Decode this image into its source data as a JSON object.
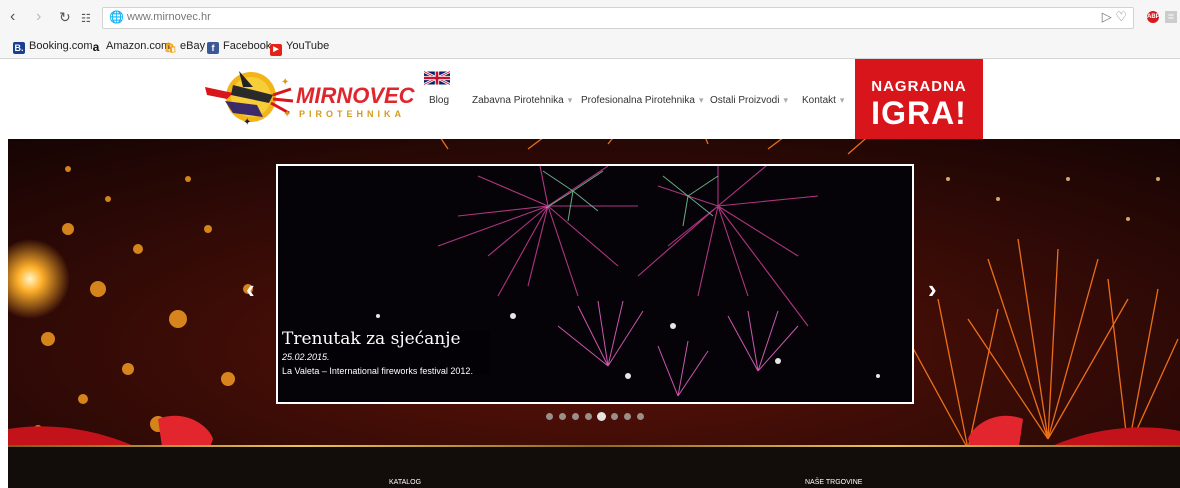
{
  "browser": {
    "url": "www.mirnovec.hr",
    "back_icon": "back-arrow-icon",
    "forward_icon": "forward-arrow-icon",
    "reload_icon": "reload-icon",
    "apps_icon": "speed-dial-icon",
    "site_icon": "globe-icon",
    "bookmarks": [
      {
        "label": "Booking.com",
        "icon": "B.",
        "color": "#1a3f8f"
      },
      {
        "label": "Amazon.com",
        "icon": "a",
        "color": "#111111"
      },
      {
        "label": "eBay",
        "icon": "🛍",
        "color": "#f2a41d"
      },
      {
        "label": "Facebook",
        "icon": "f",
        "color": "#3b5998"
      },
      {
        "label": "YouTube",
        "icon": "▶",
        "color": "#e62117"
      }
    ]
  },
  "site": {
    "logo": {
      "word": "MIRNOVEC",
      "sub": "PIROTEHNIKA"
    },
    "menu": [
      {
        "label": "Blog",
        "has_caret": false
      },
      {
        "label": "Zabavna Pirotehnika",
        "has_caret": true
      },
      {
        "label": "Profesionalna Pirotehnika",
        "has_caret": true
      },
      {
        "label": "Ostali Proizvodi",
        "has_caret": true
      },
      {
        "label": "Kontakt",
        "has_caret": true
      }
    ],
    "caret": "▾",
    "promo": {
      "line1": "NAGRADNA",
      "line2": "IGRA!"
    }
  },
  "slider": {
    "title": "Trenutak za sjećanje",
    "date": "25.02.2015.",
    "text": "La Valeta – International fireworks festival 2012.",
    "prev": "‹",
    "next": "›",
    "dot_count": 8,
    "active_dot": 4
  },
  "band": {
    "left_label": "KATALOG",
    "right_label": "NAŠE TRGOVINE"
  }
}
